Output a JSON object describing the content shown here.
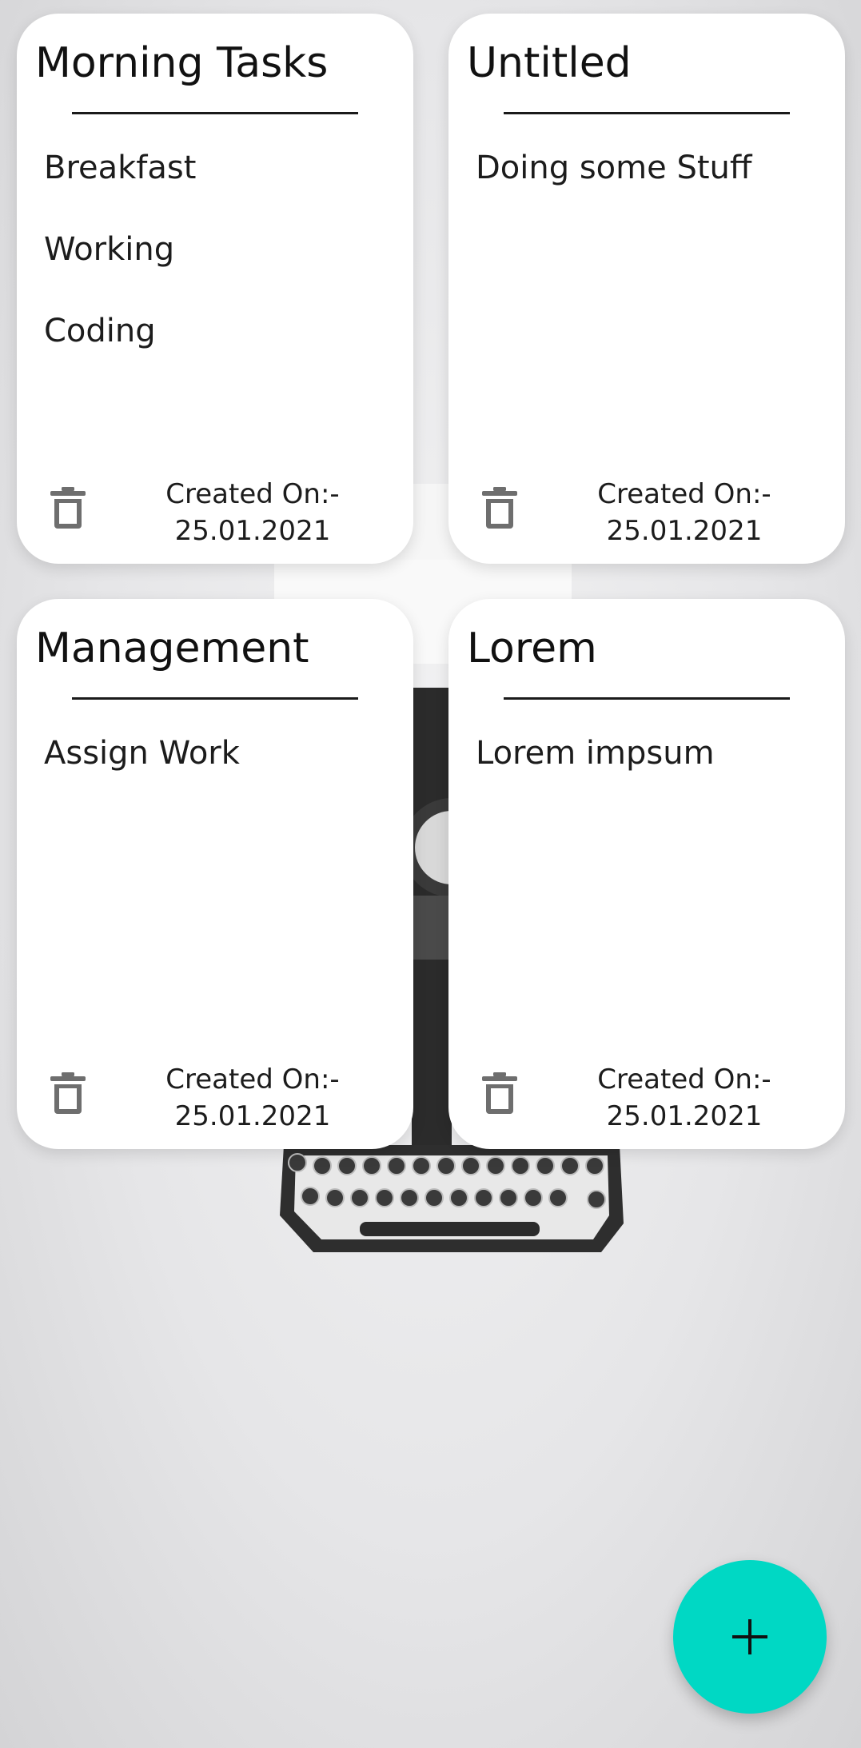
{
  "notes": [
    {
      "title": "Morning Tasks",
      "lines": [
        "Breakfast",
        "Working",
        "Coding"
      ],
      "created_label": "Created On:-",
      "created_date": "25.01.2021",
      "delete_icon": "trash-icon"
    },
    {
      "title": "Untitled",
      "lines": [
        "Doing some Stuff"
      ],
      "created_label": "Created On:-",
      "created_date": "25.01.2021",
      "delete_icon": "trash-icon"
    },
    {
      "title": "Management",
      "lines": [
        "Assign Work"
      ],
      "created_label": "Created On:-",
      "created_date": "25.01.2021",
      "delete_icon": "trash-icon"
    },
    {
      "title": "Lorem",
      "lines": [
        "Lorem impsum"
      ],
      "created_label": "Created On:-",
      "created_date": "25.01.2021",
      "delete_icon": "trash-icon"
    }
  ],
  "add_button": {
    "icon": "plus-icon",
    "color": "#00d8c4"
  },
  "colors": {
    "card": "#ffffff",
    "text": "#111111",
    "icon": "#6e6e6e"
  }
}
